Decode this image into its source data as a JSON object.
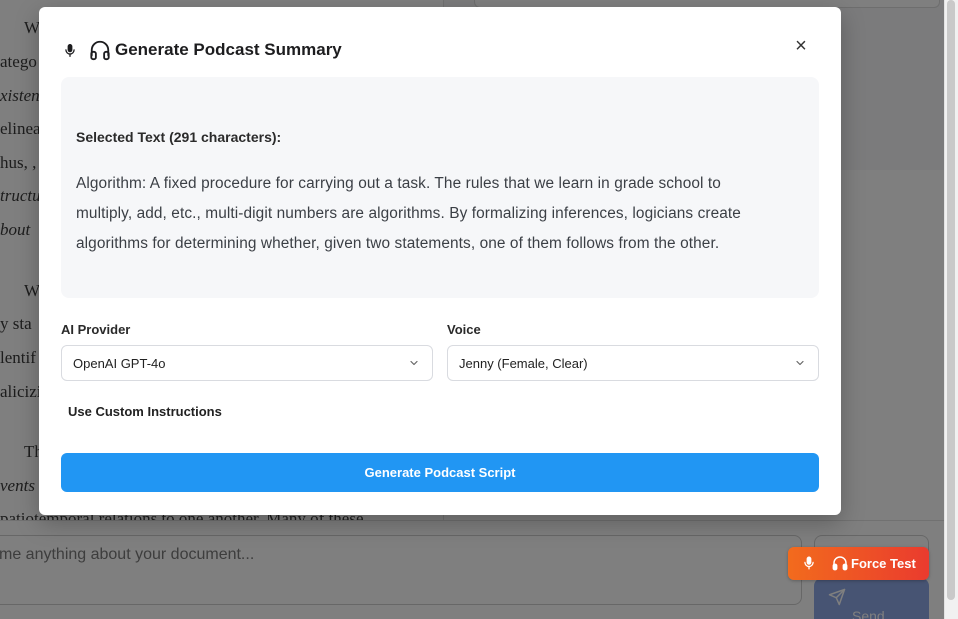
{
  "background": {
    "document_lines": [
      {
        "text": "W",
        "italic": false
      },
      {
        "text": "atego",
        "italic": false
      },
      {
        "text": "xisten",
        "italic": true
      },
      {
        "text": "elinea",
        "italic": false
      },
      {
        "text": "hus, ,",
        "italic": false
      },
      {
        "text": "tructu",
        "italic": true
      },
      {
        "text": "bout",
        "italic": true
      },
      {
        "text": "W",
        "italic": false
      },
      {
        "text": "y sta",
        "italic": false
      },
      {
        "text": "lentif",
        "italic": false
      },
      {
        "text": "alicizi",
        "italic": false
      },
      {
        "text": "Th",
        "italic": false
      },
      {
        "text": "vents",
        "italic": true
      },
      {
        "text": "patiotemporal relations to one another. Many of these",
        "italic": false
      }
    ],
    "chat_placeholder": "me anything about your document...",
    "send_label": "Send",
    "force_test_label": "Force Test"
  },
  "modal": {
    "title": "Generate Podcast Summary",
    "close_symbol": "×",
    "selected_heading": "Selected Text (291 characters):",
    "selected_lines": [
      "Algorithm: A fixed procedure for carrying out a task. The rules that we learn in grade school to",
      "multiply, add, etc., multi-digit numbers are algorithms. By formalizing inferences, logicians create",
      "algorithms for determining whether, given two statements, one of them follows from the other."
    ],
    "provider_label": "AI Provider",
    "provider_value": "OpenAI GPT-4o",
    "voice_label": "Voice",
    "voice_value": "Jenny (Female, Clear)",
    "custom_instructions_label": "Use Custom Instructions",
    "generate_button": "Generate Podcast Script"
  },
  "colors": {
    "primary": "#2196f3",
    "force_test_start": "#f26b1d",
    "force_test_end": "#ea3b2e"
  },
  "icons": [
    "microphone-icon",
    "headphones-icon",
    "close-icon",
    "chevron-down-icon",
    "send-icon"
  ]
}
